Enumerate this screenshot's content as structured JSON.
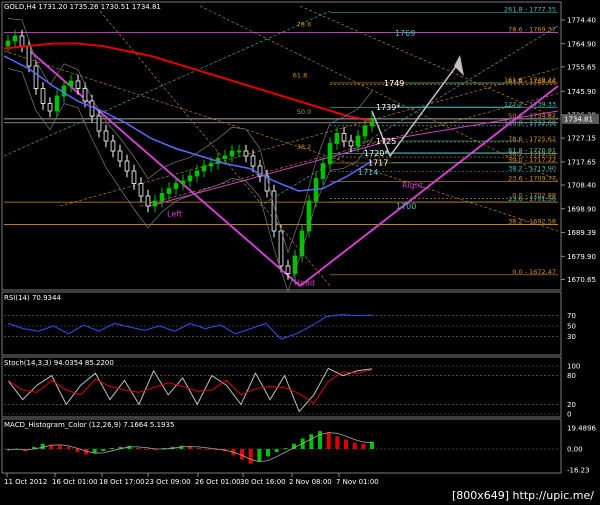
{
  "header": {
    "title": "GOLD,H4  1731.20 1735.26 1730.51 1734.81"
  },
  "colors": {
    "background": "#000000",
    "bull_candle": "#00c000",
    "bear_candle": "#ffffff",
    "magenta_channel": "#d040d0",
    "ma_red": "#e00000",
    "ma_blue": "#5a6cff",
    "bollinger": "#7a7a7a",
    "fib_orange": "#d09020",
    "fib_teal": "#40c0c0",
    "price_label_bg": "#5a5a5a",
    "macd_green": "#00c000",
    "macd_red": "#e00000",
    "rsi_line": "#3050ff",
    "stoch_main": "#c0c0c0",
    "stoch_signal": "#e00000"
  },
  "price_axis": {
    "ticks": [
      "1774.40",
      "1764.90",
      "1755.65",
      "1745.90",
      "1736.39",
      "1727.15",
      "1717.65",
      "1708.40",
      "1698.90",
      "1689.39",
      "1679.90",
      "1670.65"
    ],
    "current_price": "1734.81",
    "current_label": "1734.81"
  },
  "annotations": {
    "big_levels": [
      {
        "text": "1769",
        "price": 1769.2
      },
      {
        "text": "1749",
        "price": 1749.2
      },
      {
        "text": "1739*",
        "price": 1739.6
      },
      {
        "text": "1725",
        "price": 1726.0
      },
      {
        "text": "1720*",
        "price": 1721.3
      },
      {
        "text": "1717",
        "price": 1717.4
      },
      {
        "text": "1714",
        "price": 1713.6
      },
      {
        "text": "1700",
        "price": 1700.0
      }
    ],
    "pattern_labels": [
      "Left",
      "Head",
      "Right"
    ],
    "fib_labels": [
      {
        "text": "261.8 - 1777.35",
        "price": 1777.35
      },
      {
        "text": "78.6",
        "price": 1771.5
      },
      {
        "text": "78.6 - 1769.37",
        "price": 1769.37
      },
      {
        "text": "61.8",
        "price": 1751.0
      },
      {
        "text": "161.8 - 1749.22",
        "price": 1749.22
      },
      {
        "text": "61.8 - 1748.66",
        "price": 1748.66
      },
      {
        "text": "127.2 - 1739.33",
        "price": 1739.33
      },
      {
        "text": "50.0",
        "price": 1736.5
      },
      {
        "text": "50.0 - 1734.87",
        "price": 1734.87
      },
      {
        "text": "100.0 - 1732.08",
        "price": 1732.08
      },
      {
        "text": "38.2",
        "price": 1722.5
      },
      {
        "text": "78.6 - 1725.62",
        "price": 1725.62
      },
      {
        "text": "61.8 - 1720.91",
        "price": 1720.91
      },
      {
        "text": "38.2 - 1719.56",
        "price": 1719.56
      },
      {
        "text": "50.0 - 1717.22",
        "price": 1717.22
      },
      {
        "text": "38.2 - 1713.90",
        "price": 1713.9
      },
      {
        "text": "23.6 - 1709.77",
        "price": 1709.77
      },
      {
        "text": "0.0 - 1702.98",
        "price": 1702.98
      },
      {
        "text": "23.6 - 1701.56",
        "price": 1701.56
      },
      {
        "text": "38.2 - 1692.58",
        "price": 1692.58
      },
      {
        "text": "0.0 - 1672.47",
        "price": 1672.47
      }
    ]
  },
  "rsi": {
    "title": "RSI(14) 70.9344",
    "levels": [
      "70",
      "50",
      "30"
    ]
  },
  "stoch": {
    "title": "Stoch(14,3,3) 94.0354 85.2200",
    "levels": [
      "100",
      "80",
      "20",
      "0"
    ]
  },
  "macd": {
    "title": "MACD_Histogram_Color (12,26,9)  7.1664 5.1935",
    "levels": [
      "19.4896",
      "0.00",
      "-16.23"
    ]
  },
  "time_axis": [
    "11 Oct 2012",
    "16 Oct 01:00",
    "18 Oct 17:00",
    "23 Oct 09:00",
    "26 Oct 01:00",
    "30 Oct 16:00",
    "2 Nov 08:00",
    "7 Nov 01:00"
  ],
  "watermark": "[800x649] http://upic.me/",
  "chart_data": {
    "type": "candlestick",
    "title": "GOLD,H4  1731.20 1735.26 1730.51 1734.81",
    "ylim": [
      1668,
      1780
    ],
    "categories": [
      "11 Oct 2012",
      "16 Oct 01:00",
      "18 Oct 17:00",
      "23 Oct 09:00",
      "26 Oct 01:00",
      "30 Oct 16:00",
      "2 Nov 08:00",
      "7 Nov 01:00"
    ],
    "series": [
      {
        "name": "GOLD,H4",
        "values": [
          1766,
          1768,
          1764,
          1756,
          1747,
          1741,
          1738,
          1744,
          1748,
          1750,
          1747,
          1742,
          1736,
          1730,
          1726,
          1722,
          1718,
          1714,
          1709,
          1704,
          1700,
          1702,
          1705,
          1707,
          1709,
          1710,
          1712,
          1714,
          1716,
          1717,
          1719,
          1720,
          1722,
          1722,
          1720,
          1716,
          1712,
          1706,
          1690,
          1676,
          1673,
          1680,
          1690,
          1702,
          1711,
          1717,
          1725,
          1729,
          1726,
          1724,
          1728,
          1732,
          1735
        ]
      },
      {
        "name": "MA red",
        "values": [
          1763,
          1764,
          1765,
          1765,
          1764,
          1762,
          1760,
          1757,
          1754,
          1751,
          1748,
          1745,
          1742,
          1739,
          1736,
          1734
        ]
      },
      {
        "name": "MA blue",
        "values": [
          1760,
          1755,
          1748,
          1742,
          1738,
          1733,
          1727,
          1723,
          1720,
          1717,
          1715,
          1710,
          1706,
          1707,
          1712,
          1718
        ]
      },
      {
        "name": "RSI(14)",
        "values": [
          55,
          45,
          40,
          50,
          35,
          52,
          40,
          55,
          48,
          42,
          50,
          40,
          55,
          45,
          52,
          35,
          45,
          55,
          25,
          35,
          50,
          68,
          72,
          70,
          71
        ]
      },
      {
        "name": "Stoch main",
        "values": [
          70,
          30,
          60,
          80,
          20,
          60,
          85,
          30,
          70,
          20,
          90,
          40,
          75,
          20,
          80,
          60,
          20,
          85,
          30,
          80,
          5,
          40,
          95,
          80,
          90,
          94
        ]
      },
      {
        "name": "MACD histogram",
        "values": [
          -1,
          0,
          -2,
          2,
          5,
          4,
          3,
          2,
          -3,
          -5,
          -4,
          -2,
          1,
          2,
          3,
          1,
          0,
          -1,
          1,
          2,
          3,
          2,
          1,
          0,
          -1,
          -2,
          -6,
          -10,
          -14,
          -12,
          -7,
          -3,
          1,
          5,
          10,
          14,
          17,
          16,
          12,
          9,
          6,
          5,
          7
        ]
      }
    ]
  }
}
